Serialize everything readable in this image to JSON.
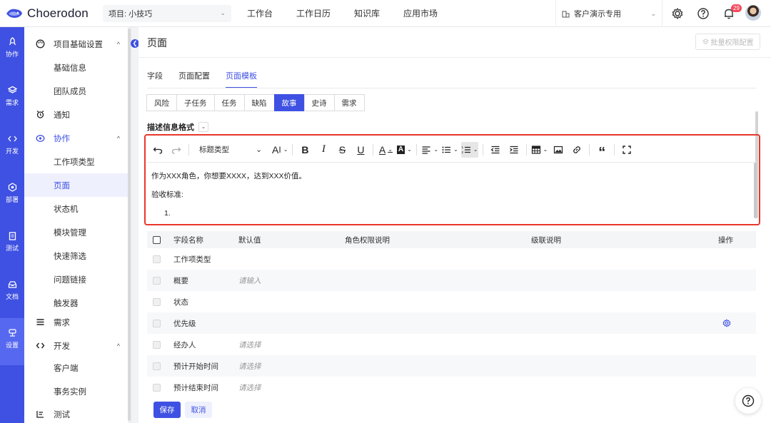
{
  "header": {
    "logo_text": "Choerodon",
    "project_select": "项目: 小技巧",
    "nav": [
      "工作台",
      "工作日历",
      "知识库",
      "应用市场"
    ],
    "org_select": "客户演示专用",
    "notification_count": "29"
  },
  "rail": {
    "items": [
      {
        "label": "协作",
        "icon": "rocket-icon"
      },
      {
        "label": "需求",
        "icon": "layers-icon"
      },
      {
        "label": "开发",
        "icon": "code-icon"
      },
      {
        "label": "部署",
        "icon": "deploy-icon"
      },
      {
        "label": "测试",
        "icon": "clipboard-icon"
      },
      {
        "label": "文档",
        "icon": "inbox-icon"
      },
      {
        "label": "设置",
        "icon": "settings-icon"
      }
    ],
    "active": "设置"
  },
  "subnav": {
    "items": [
      {
        "label": "项目基础设置",
        "type": "group",
        "caret": "^"
      },
      {
        "label": "基础信息",
        "type": "sub"
      },
      {
        "label": "团队成员",
        "type": "sub"
      },
      {
        "label": "通知",
        "type": "group"
      },
      {
        "label": "协作",
        "type": "group",
        "caret": "^"
      },
      {
        "label": "工作项类型",
        "type": "sub"
      },
      {
        "label": "页面",
        "type": "sub",
        "active": true
      },
      {
        "label": "状态机",
        "type": "sub"
      },
      {
        "label": "模块管理",
        "type": "sub"
      },
      {
        "label": "快速筛选",
        "type": "sub"
      },
      {
        "label": "问题链接",
        "type": "sub"
      },
      {
        "label": "触发器",
        "type": "sub"
      },
      {
        "label": "需求",
        "type": "group"
      },
      {
        "label": "开发",
        "type": "group",
        "caret": "^"
      },
      {
        "label": "客户端",
        "type": "sub"
      },
      {
        "label": "事务实例",
        "type": "sub"
      },
      {
        "label": "测试",
        "type": "group"
      }
    ]
  },
  "main": {
    "title": "页面",
    "batch_button": "批量权限配置",
    "tabs": [
      "字段",
      "页面配置",
      "页面模板"
    ],
    "active_tab": "页面模板",
    "issue_types": [
      "风险",
      "子任务",
      "任务",
      "缺陷",
      "故事",
      "史诗",
      "需求"
    ],
    "active_type": "故事",
    "desc_label": "描述信息格式",
    "editor": {
      "heading_select": "标题类型",
      "line1": "作为XXX角色，你想要XXXX，达到XXX价值。",
      "line2": "验收标准:",
      "line3": "1."
    },
    "table": {
      "headers": [
        "字段名称",
        "默认值",
        "角色权限说明",
        "级联说明",
        "操作"
      ],
      "rows": [
        {
          "name": "工作项类型",
          "default": ""
        },
        {
          "name": "概要",
          "default": "请输入"
        },
        {
          "name": "状态",
          "default": ""
        },
        {
          "name": "优先级",
          "default": "",
          "gear": true
        },
        {
          "name": "经办人",
          "default": "请选择"
        },
        {
          "name": "预计开始时间",
          "default": "请选择"
        },
        {
          "name": "预计结束时间",
          "default": "请选择"
        }
      ]
    },
    "save_label": "保存",
    "cancel_label": "取消"
  },
  "colors": {
    "primary": "#3f51e2",
    "highlight_outline": "#e8372b",
    "badge": "#f5475b"
  }
}
